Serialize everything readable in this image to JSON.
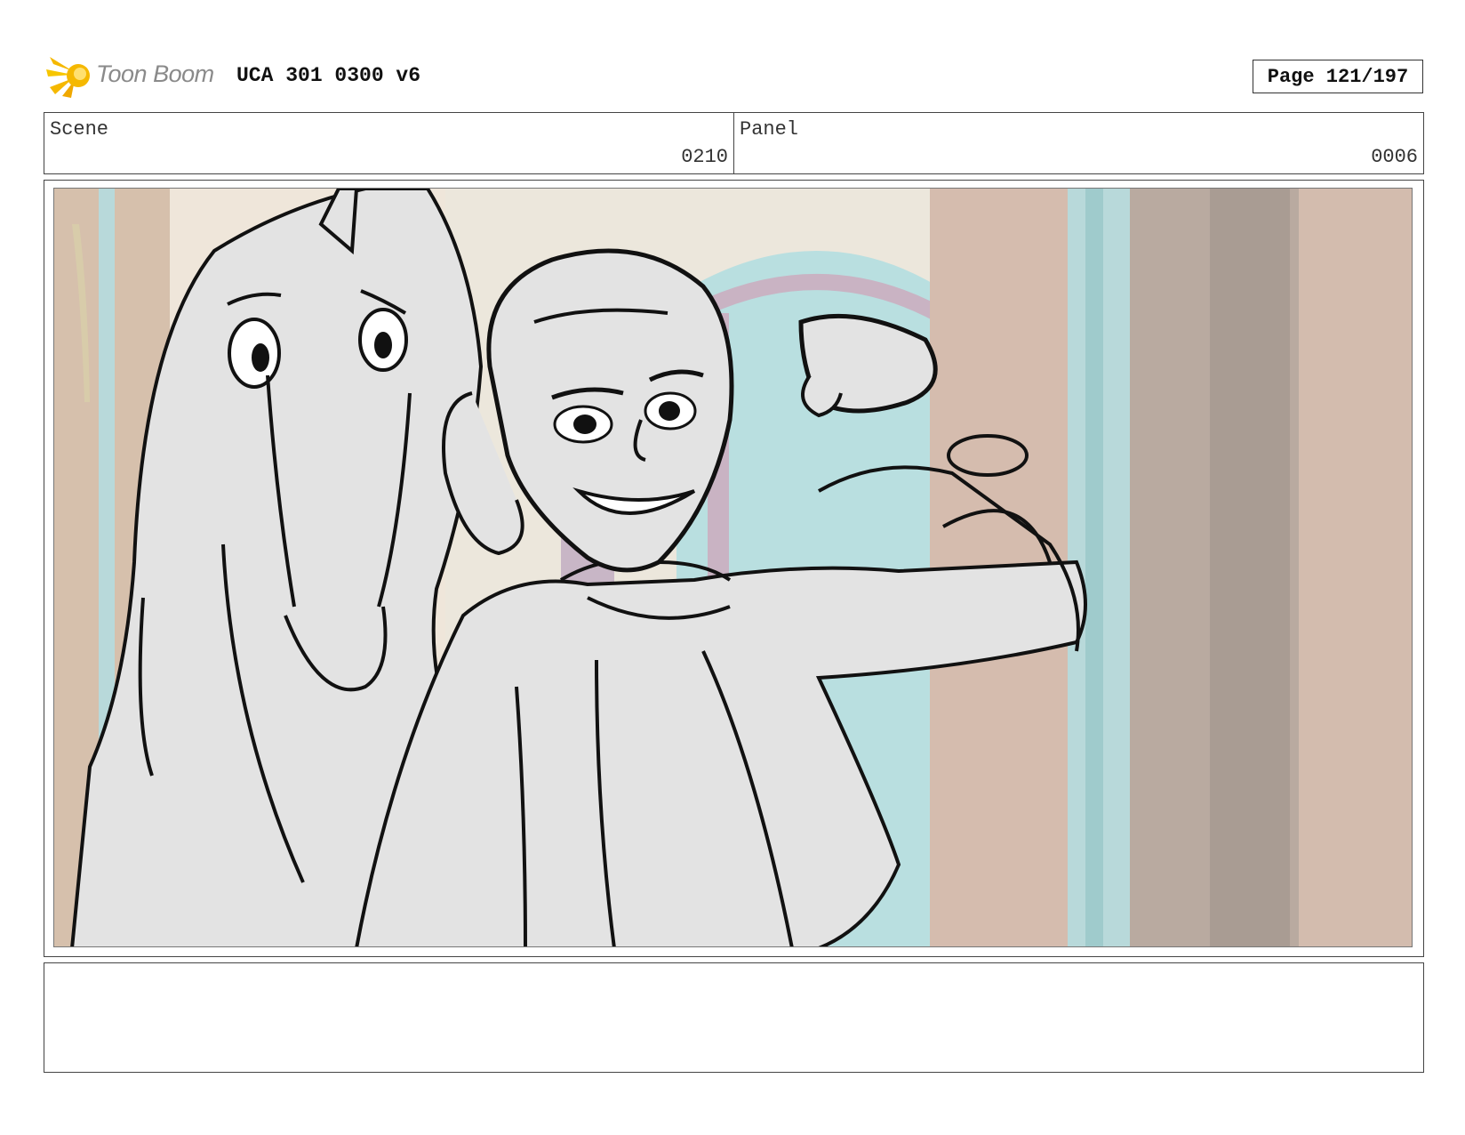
{
  "header": {
    "logo_text": "Toon Boom",
    "title": "UCA 301 0300 v6",
    "page_label": "Page 121/197"
  },
  "info": {
    "scene_label": "Scene",
    "scene_value": "0210",
    "panel_label": "Panel",
    "panel_value": "0006"
  },
  "panel": {
    "icons": [
      "toon-boom-logo-icon"
    ]
  },
  "notes": {
    "text": ""
  },
  "colors": {
    "logo_yellow": "#f5b800",
    "border": "#444444",
    "curtain_pink": "#d8c0b0",
    "window_blue": "#b9dfe0",
    "sketch_fill": "#e3e3e3"
  }
}
